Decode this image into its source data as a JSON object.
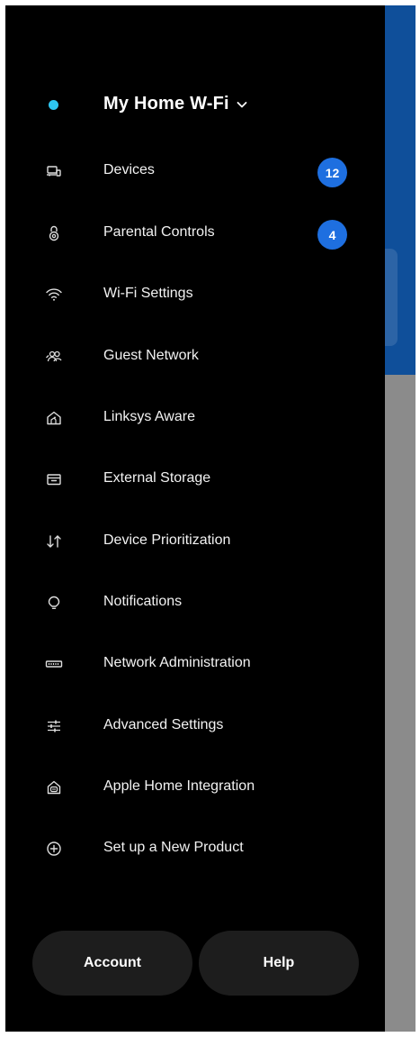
{
  "network": {
    "name": "My Home W-Fi",
    "status_color": "#2ec7f2"
  },
  "menu": [
    {
      "label": "Devices",
      "icon": "devices-icon",
      "badge": "12"
    },
    {
      "label": "Parental Controls",
      "icon": "lock-icon",
      "badge": "4"
    },
    {
      "label": "Wi-Fi Settings",
      "icon": "wifi-icon"
    },
    {
      "label": "Guest Network",
      "icon": "guests-icon"
    },
    {
      "label": "Linksys Aware",
      "icon": "home-motion-icon"
    },
    {
      "label": "External Storage",
      "icon": "storage-icon"
    },
    {
      "label": "Device Prioritization",
      "icon": "priority-arrows-icon"
    },
    {
      "label": "Notifications",
      "icon": "bell-icon"
    },
    {
      "label": "Network Administration",
      "icon": "router-icon"
    },
    {
      "label": "Advanced Settings",
      "icon": "sliders-icon"
    },
    {
      "label": "Apple Home Integration",
      "icon": "apple-home-icon"
    },
    {
      "label": "Set up a New Product",
      "icon": "plus-circle-icon"
    }
  ],
  "footer": {
    "account_label": "Account",
    "help_label": "Help"
  },
  "colors": {
    "badge": "#1e6fe0",
    "drawer_bg": "#000000",
    "button_bg": "#1d1d1d",
    "backdrop_blue": "#0f4f9a",
    "backdrop_gray": "#8b8b8b"
  }
}
